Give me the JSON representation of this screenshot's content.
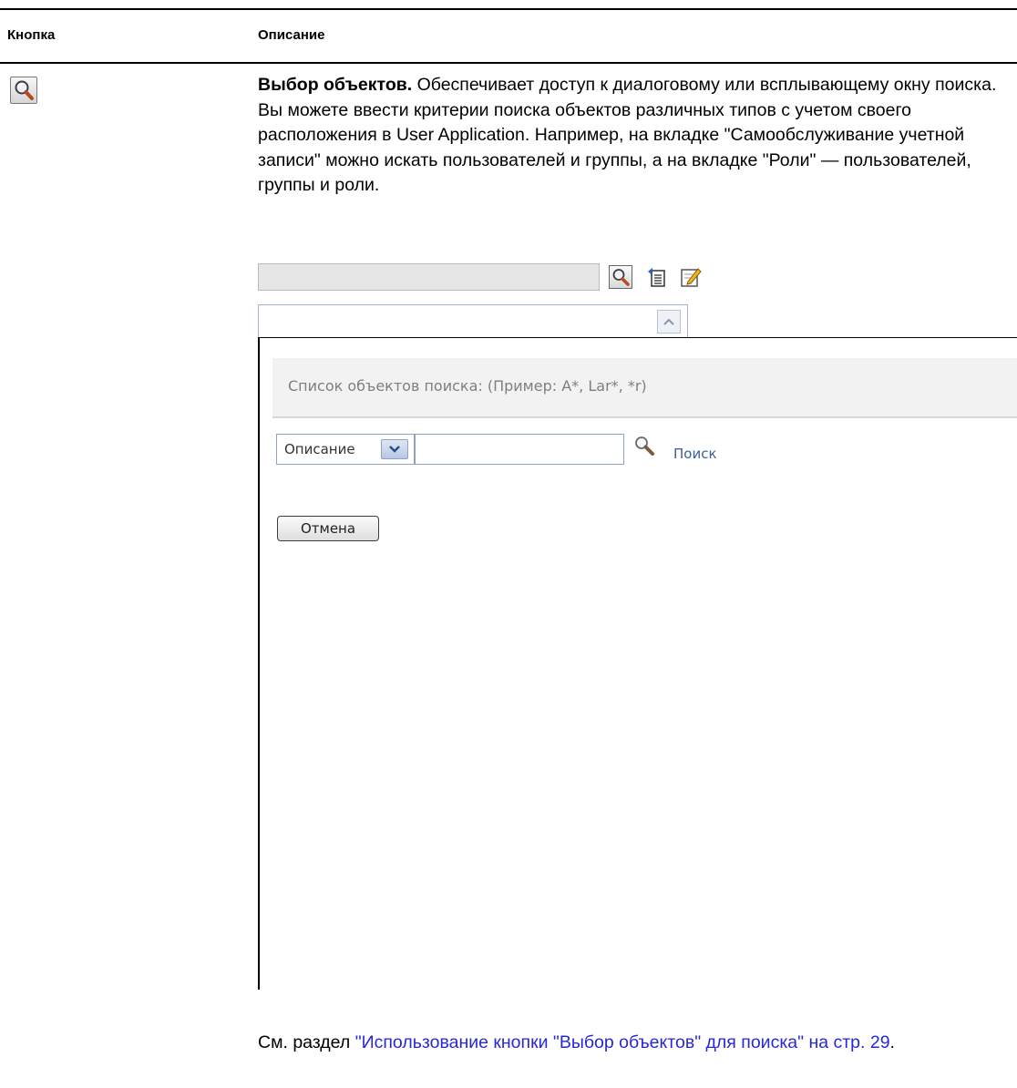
{
  "table": {
    "header_button": "Кнопка",
    "header_description": "Описание"
  },
  "row": {
    "icon": "magnifier-icon",
    "title": "Выбор объектов.",
    "text": " Обеспечивает доступ к диалоговому или всплывающему окну поиска. Вы можете ввести критерии поиска объектов различных типов с учетом своего расположения в User Application. Например, на вкладке \"Самообслуживание учетной записи\" можно искать пользователей и группы, а на вкладке \"Роли\" — пользователей, группы и роли."
  },
  "screenshot": {
    "toolbar_icons": [
      "magnifier-icon",
      "history-icon",
      "edit-icon"
    ],
    "popup": {
      "heading": "Список объектов поиска: (Пример: A*, Lar*, *r)",
      "attribute_select_value": "Описание",
      "search_term_value": "",
      "search_link": "Поиск",
      "cancel_button": "Отмена"
    }
  },
  "see_also": {
    "prefix": "См. раздел ",
    "link_text": "\"Использование кнопки \"Выбор объектов\" для поиска\" на стр. 29",
    "suffix": "."
  },
  "colors": {
    "link": "#2828d6",
    "popup_link": "#3d5f95",
    "popup_header_bg": "#f2f2f2"
  }
}
